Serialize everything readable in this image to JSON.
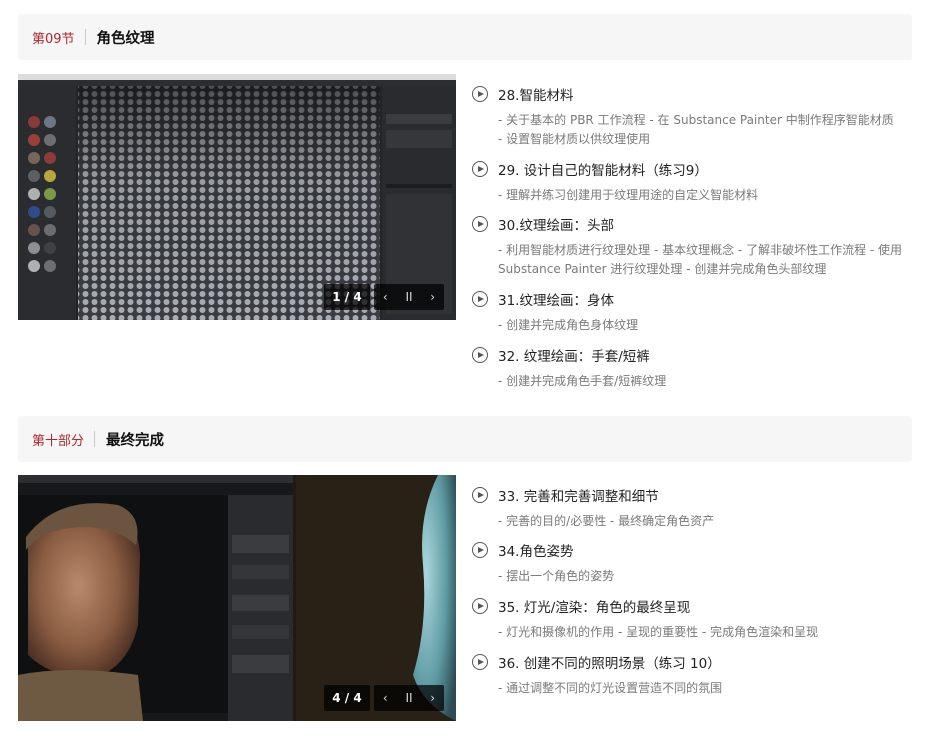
{
  "sections": [
    {
      "label": "第09节",
      "title": "角色纹理",
      "media": {
        "counter": "1 / 4",
        "prev": "‹",
        "pause": "II",
        "next": "›"
      },
      "lessons": [
        {
          "title": "28.智能材料",
          "desc": "- 关于基本的 PBR 工作流程 - 在 Substance Painter 中制作程序智能材质\n- 设置智能材质以供纹理使用"
        },
        {
          "title": "29. 设计自己的智能材料（练习9）",
          "desc": "- 理解并练习创建用于纹理用途的自定义智能材料"
        },
        {
          "title": "30.纹理绘画：头部",
          "desc": "- 利用智能材质进行纹理处理 - 基本纹理概念 - 了解非破坏性工作流程 - 使用 Substance Painter 进行纹理处理 - 创建并完成角色头部纹理"
        },
        {
          "title": "31.纹理绘画：身体",
          "desc": "- 创建并完成角色身体纹理"
        },
        {
          "title": "32. 纹理绘画：手套/短裤",
          "desc": "- 创建并完成角色手套/短裤纹理"
        }
      ]
    },
    {
      "label": "第十部分",
      "title": "最终完成",
      "media": {
        "counter": "4 / 4",
        "prev": "‹",
        "pause": "II",
        "next": "›"
      },
      "lessons": [
        {
          "title": "33. 完善和完善调整和细节",
          "desc": "- 完善的目的/必要性 - 最终确定角色资产"
        },
        {
          "title": "34.角色姿势",
          "desc": "- 摆出一个角色的姿势"
        },
        {
          "title": "35. 灯光/渲染：角色的最终呈现",
          "desc": "- 灯光和摄像机的作用 - 呈现的重要性 - 完成角色渲染和呈现"
        },
        {
          "title": "36. 创建不同的照明场景（练习 10）",
          "desc": "- 通过调整不同的灯光设置营造不同的氛围"
        }
      ]
    }
  ]
}
